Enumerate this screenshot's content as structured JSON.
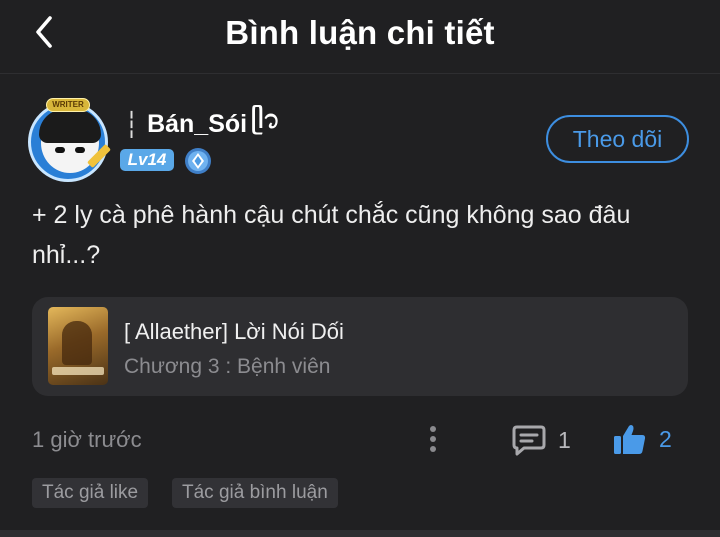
{
  "header": {
    "title": "Bình luận chi tiết"
  },
  "user": {
    "name": "Bán_Sói",
    "name_prefix": "┆",
    "name_suffix": "ᥫ᭡",
    "level": "Lv14",
    "avatar_badge": "WRITER"
  },
  "actions": {
    "follow_label": "Theo dõi"
  },
  "comment": {
    "text": "+ 2 ly cà phê hành cậu chút chắc cũng không sao đâu nhỉ...?",
    "time": "1 giờ trước",
    "reply_count": "1",
    "like_count": "2"
  },
  "book": {
    "title": "[ Allaether] Lời Nói Dối",
    "chapter": "Chương 3 : Bệnh viên"
  },
  "tags": [
    "Tác giả like",
    "Tác giả bình luận"
  ],
  "colors": {
    "background": "#202022",
    "accent": "#4a9ae8",
    "card": "#2e2e31",
    "muted_text": "#8c8c90"
  }
}
